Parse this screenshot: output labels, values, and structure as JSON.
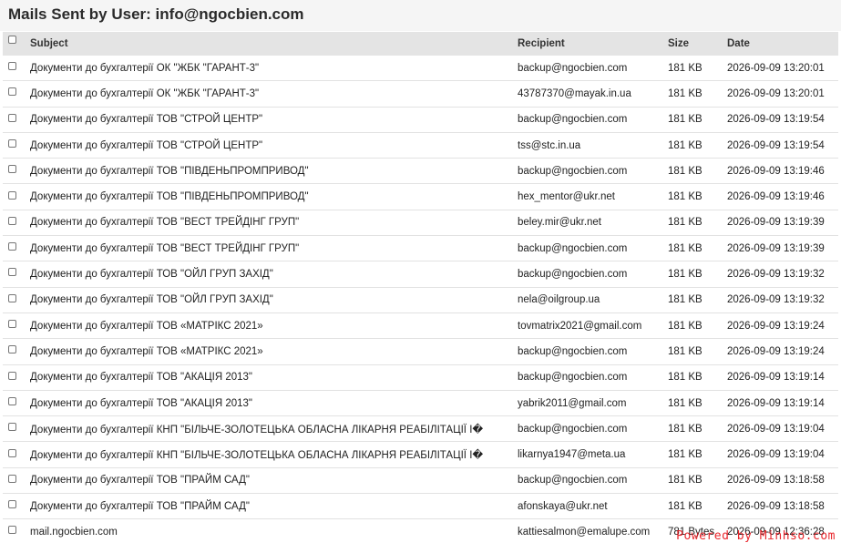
{
  "header": {
    "title": "Mails Sent by User: info@ngocbien.com"
  },
  "table": {
    "columns": {
      "subject": "Subject",
      "recipient": "Recipient",
      "size": "Size",
      "date": "Date"
    },
    "rows": [
      {
        "subject": "Документи до бухгалтерії ОК \"ЖБК \"ГАРАНТ-3\"",
        "recipient": "backup@ngocbien.com",
        "size": "181 KB",
        "date": "2026-09-09 13:20:01"
      },
      {
        "subject": "Документи до бухгалтерії ОК \"ЖБК \"ГАРАНТ-3\"",
        "recipient": "43787370@mayak.in.ua",
        "size": "181 KB",
        "date": "2026-09-09 13:20:01"
      },
      {
        "subject": "Документи до бухгалтерії ТОВ \"СТРОЙ ЦЕНТР\"",
        "recipient": "backup@ngocbien.com",
        "size": "181 KB",
        "date": "2026-09-09 13:19:54"
      },
      {
        "subject": "Документи до бухгалтерії ТОВ \"СТРОЙ ЦЕНТР\"",
        "recipient": "tss@stc.in.ua",
        "size": "181 KB",
        "date": "2026-09-09 13:19:54"
      },
      {
        "subject": "Документи до бухгалтерії ТОВ \"ПІВДЕНЬПРОМПРИВОД\"",
        "recipient": "backup@ngocbien.com",
        "size": "181 KB",
        "date": "2026-09-09 13:19:46"
      },
      {
        "subject": "Документи до бухгалтерії ТОВ \"ПІВДЕНЬПРОМПРИВОД\"",
        "recipient": "hex_mentor@ukr.net",
        "size": "181 KB",
        "date": "2026-09-09 13:19:46"
      },
      {
        "subject": "Документи до бухгалтерії ТОВ \"ВЕСТ ТРЕЙДІНГ ГРУП\"",
        "recipient": "beley.mir@ukr.net",
        "size": "181 KB",
        "date": "2026-09-09 13:19:39"
      },
      {
        "subject": "Документи до бухгалтерії ТОВ \"ВЕСТ ТРЕЙДІНГ ГРУП\"",
        "recipient": "backup@ngocbien.com",
        "size": "181 KB",
        "date": "2026-09-09 13:19:39"
      },
      {
        "subject": "Документи до бухгалтерії ТОВ \"ОЙЛ ГРУП ЗАХІД\"",
        "recipient": "backup@ngocbien.com",
        "size": "181 KB",
        "date": "2026-09-09 13:19:32"
      },
      {
        "subject": "Документи до бухгалтерії ТОВ \"ОЙЛ ГРУП ЗАХІД\"",
        "recipient": "nela@oilgroup.ua",
        "size": "181 KB",
        "date": "2026-09-09 13:19:32"
      },
      {
        "subject": "Документи до бухгалтерії ТОВ «МАТРІКС 2021»",
        "recipient": "tovmatrix2021@gmail.com",
        "size": "181 KB",
        "date": "2026-09-09 13:19:24"
      },
      {
        "subject": "Документи до бухгалтерії ТОВ «МАТРІКС 2021»",
        "recipient": "backup@ngocbien.com",
        "size": "181 KB",
        "date": "2026-09-09 13:19:24"
      },
      {
        "subject": "Документи до бухгалтерії ТОВ \"АКАЦІЯ 2013\"",
        "recipient": "backup@ngocbien.com",
        "size": "181 KB",
        "date": "2026-09-09 13:19:14"
      },
      {
        "subject": "Документи до бухгалтерії ТОВ \"АКАЦІЯ 2013\"",
        "recipient": "yabrik2011@gmail.com",
        "size": "181 KB",
        "date": "2026-09-09 13:19:14"
      },
      {
        "subject": "Документи до бухгалтерії КНП \"БІЛЬЧЕ-ЗОЛОТЕЦЬКА ОБЛАСНА ЛІКАРНЯ РЕАБІЛІТАЦІЇ І�",
        "recipient": "backup@ngocbien.com",
        "size": "181 KB",
        "date": "2026-09-09 13:19:04"
      },
      {
        "subject": "Документи до бухгалтерії КНП \"БІЛЬЧЕ-ЗОЛОТЕЦЬКА ОБЛАСНА ЛІКАРНЯ РЕАБІЛІТАЦІЇ І�",
        "recipient": "likarnya1947@meta.ua",
        "size": "181 KB",
        "date": "2026-09-09 13:19:04"
      },
      {
        "subject": "Документи до бухгалтерії ТОВ \"ПРАЙМ САД\"",
        "recipient": "backup@ngocbien.com",
        "size": "181 KB",
        "date": "2026-09-09 13:18:58"
      },
      {
        "subject": "Документи до бухгалтерії ТОВ \"ПРАЙМ САД\"",
        "recipient": "afonskaya@ukr.net",
        "size": "181 KB",
        "date": "2026-09-09 13:18:58"
      },
      {
        "subject": "mail.ngocbien.com",
        "recipient": "kattiesalmon@emalupe.com",
        "size": "781 Bytes",
        "date": "2026-09-09 12:36:28"
      }
    ]
  },
  "watermark": {
    "text": "Powered by Minhso.com",
    "color": "#e8141b"
  }
}
